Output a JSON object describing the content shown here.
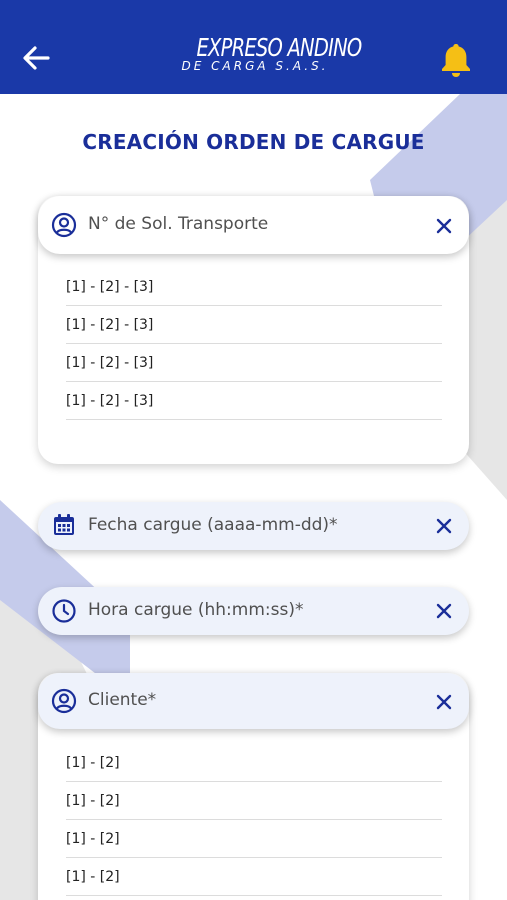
{
  "header": {
    "logo_line1": "EXPRESO ANDINO",
    "logo_line2": "DE CARGA S.A.S."
  },
  "page_title": "CREACIÓN ORDEN DE CARGUE",
  "fields": {
    "transport": {
      "label": "N° de Sol. Transporte",
      "options": [
        "[1] - [2] - [3]",
        "[1] - [2] - [3]",
        "[1] - [2] - [3]",
        "[1] - [2] - [3]"
      ]
    },
    "date": {
      "label": "Fecha cargue (aaaa-mm-dd)*"
    },
    "time": {
      "label": "Hora cargue (hh:mm:ss)*"
    },
    "client": {
      "label": "Cliente*",
      "options": [
        "[1] - [2]",
        "[1] - [2]",
        "[1] - [2]",
        "[1] - [2]"
      ]
    }
  },
  "colors": {
    "primary": "#1a39a8",
    "title": "#1a2e99",
    "bell": "#f5bf15",
    "shape": "#c5cbeb"
  },
  "icons": {
    "back": "arrow-left-icon",
    "bell": "bell-icon",
    "user": "account-circle-icon",
    "calendar": "calendar-icon",
    "clock": "clock-icon",
    "clear": "close-icon"
  }
}
